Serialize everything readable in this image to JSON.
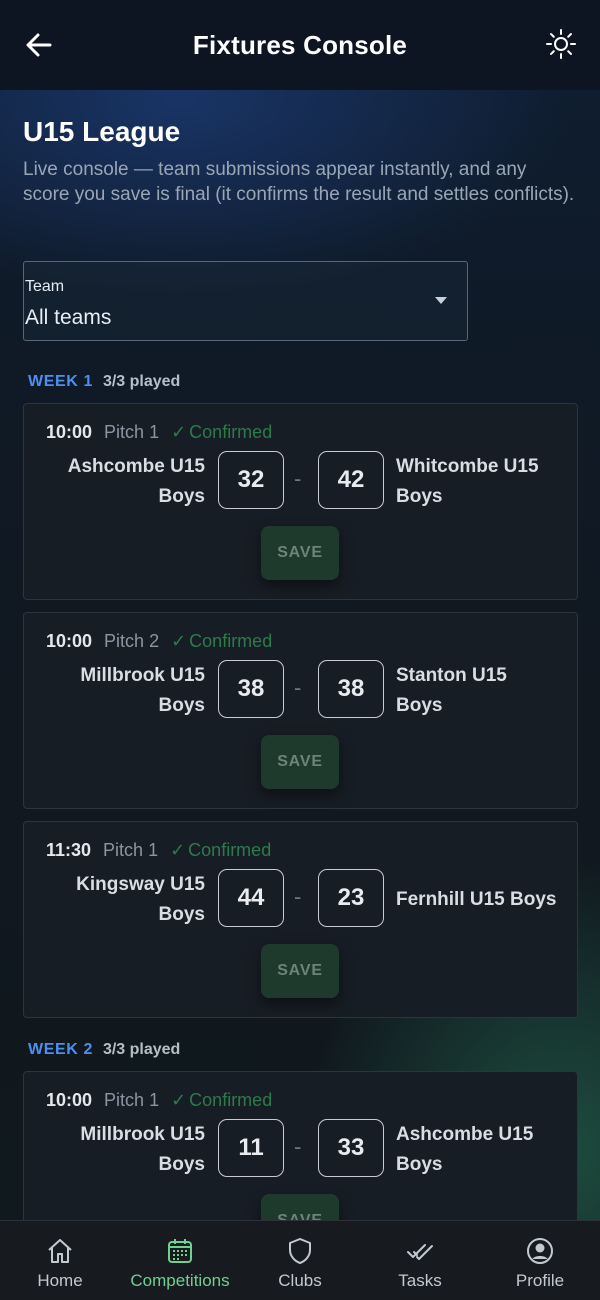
{
  "app": {
    "title": "Fixtures Console"
  },
  "league": {
    "title": "U15 League",
    "description": "Live console — team submissions appear instantly, and any score you save is final (it confirms the result and settles conflicts)."
  },
  "team_filter": {
    "label": "Team",
    "value": "All teams"
  },
  "weeks": [
    {
      "label": "WEEK 1",
      "played": "3/3 played",
      "fixtures": [
        {
          "time": "10:00",
          "pitch": "Pitch 1",
          "status": "Confirmed",
          "home_l1": "Ashcombe U15",
          "home_l2": "Boys",
          "home_score": "32",
          "away_score": "42",
          "away_l1": "Whitcombe U15",
          "away_l2": "Boys",
          "save": "SAVE"
        },
        {
          "time": "10:00",
          "pitch": "Pitch 2",
          "status": "Confirmed",
          "home_l1": "Millbrook U15",
          "home_l2": "Boys",
          "home_score": "38",
          "away_score": "38",
          "away_l1": "Stanton U15",
          "away_l2": "Boys",
          "save": "SAVE"
        },
        {
          "time": "11:30",
          "pitch": "Pitch 1",
          "status": "Confirmed",
          "home_l1": "Kingsway U15",
          "home_l2": "Boys",
          "home_score": "44",
          "away_score": "23",
          "away_l1": "Fernhill U15 Boys",
          "away_l2": "",
          "save": "SAVE"
        }
      ]
    },
    {
      "label": "WEEK 2",
      "played": "3/3 played",
      "fixtures": [
        {
          "time": "10:00",
          "pitch": "Pitch 1",
          "status": "Confirmed",
          "home_l1": "Millbrook U15",
          "home_l2": "Boys",
          "home_score": "11",
          "away_score": "33",
          "away_l1": "Ashcombe U15",
          "away_l2": "Boys",
          "save": "SAVE"
        }
      ]
    }
  ],
  "nav": {
    "items": [
      {
        "label": "Home",
        "icon": "home-icon"
      },
      {
        "label": "Competitions",
        "icon": "calendar-icon",
        "active": true
      },
      {
        "label": "Clubs",
        "icon": "shield-icon"
      },
      {
        "label": "Tasks",
        "icon": "double-check-icon"
      },
      {
        "label": "Profile",
        "icon": "account-circle-icon"
      }
    ]
  },
  "colors": {
    "accent_green": "#6fd08f",
    "week_blue": "#4d8ff0",
    "confirmed_green": "#2f7a4a"
  }
}
